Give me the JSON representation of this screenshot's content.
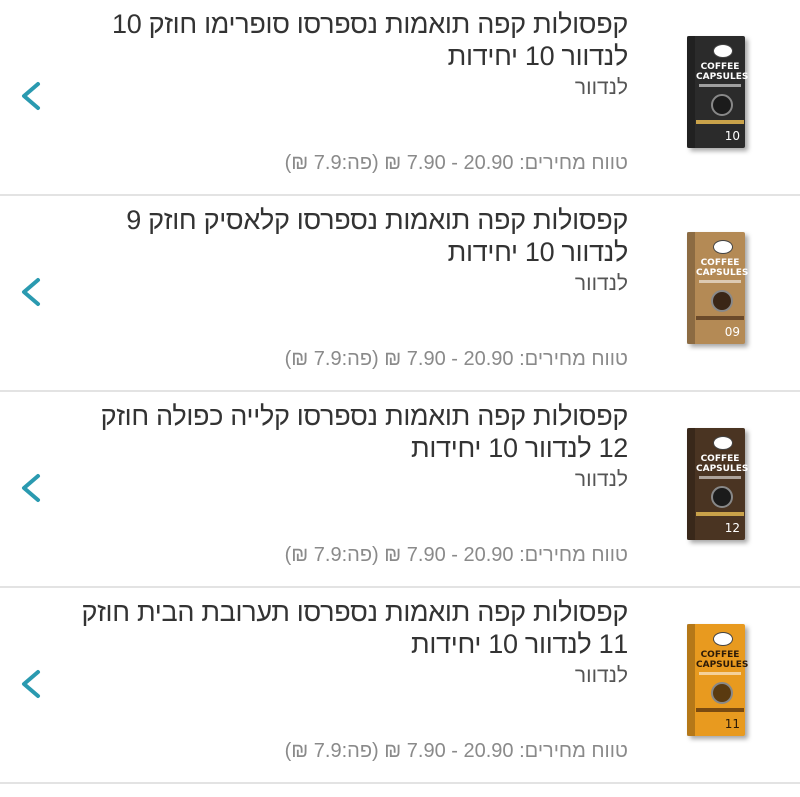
{
  "products": [
    {
      "title": "קפסולות קפה תואמות נספרסו סופרימו חוזק 10 לנדוור 10 יחידות",
      "brand": "לנדוור",
      "price_range": "טווח מחירים: 20.90 - 7.90 ₪ (פה:7.9 ₪)",
      "image": {
        "label": "COFFEE CAPSULES",
        "number": "10",
        "color": "#2b2b2b",
        "band": "#c9a24a"
      }
    },
    {
      "title": "קפסולות קפה תואמות נספרסו קלאסיק חוזק 9 לנדוור 10 יחידות",
      "brand": "לנדוור",
      "price_range": "טווח מחירים: 20.90 - 7.90 ₪ (פה:7.9 ₪)",
      "image": {
        "label": "COFFEE CAPSULES",
        "number": "09",
        "color": "#b48a55",
        "band": "#6b4a2a"
      }
    },
    {
      "title": "קפסולות קפה תואמות נספרסו קלייה כפולה חוזק 12 לנדוור 10 יחידות",
      "brand": "לנדוור",
      "price_range": "טווח מחירים: 20.90 - 7.90 ₪ (פה:7.9 ₪)",
      "image": {
        "label": "COFFEE CAPSULES",
        "number": "12",
        "color": "#4a3422",
        "band": "#c9a24a"
      }
    },
    {
      "title": "קפסולות קפה תואמות נספרסו תערובת הבית חוזק 11 לנדוור 10 יחידות",
      "brand": "לנדוור",
      "price_range": "טווח מחירים: 20.90 - 7.90 ₪ (פה:7.9 ₪)",
      "image": {
        "label": "COFFEE CAPSULES",
        "number": "11",
        "color": "#e89a1f",
        "band": "#7a4a10"
      }
    }
  ],
  "icons": {
    "chevron": "chevron-left-icon",
    "chevron_color": "#2a9ab0"
  }
}
